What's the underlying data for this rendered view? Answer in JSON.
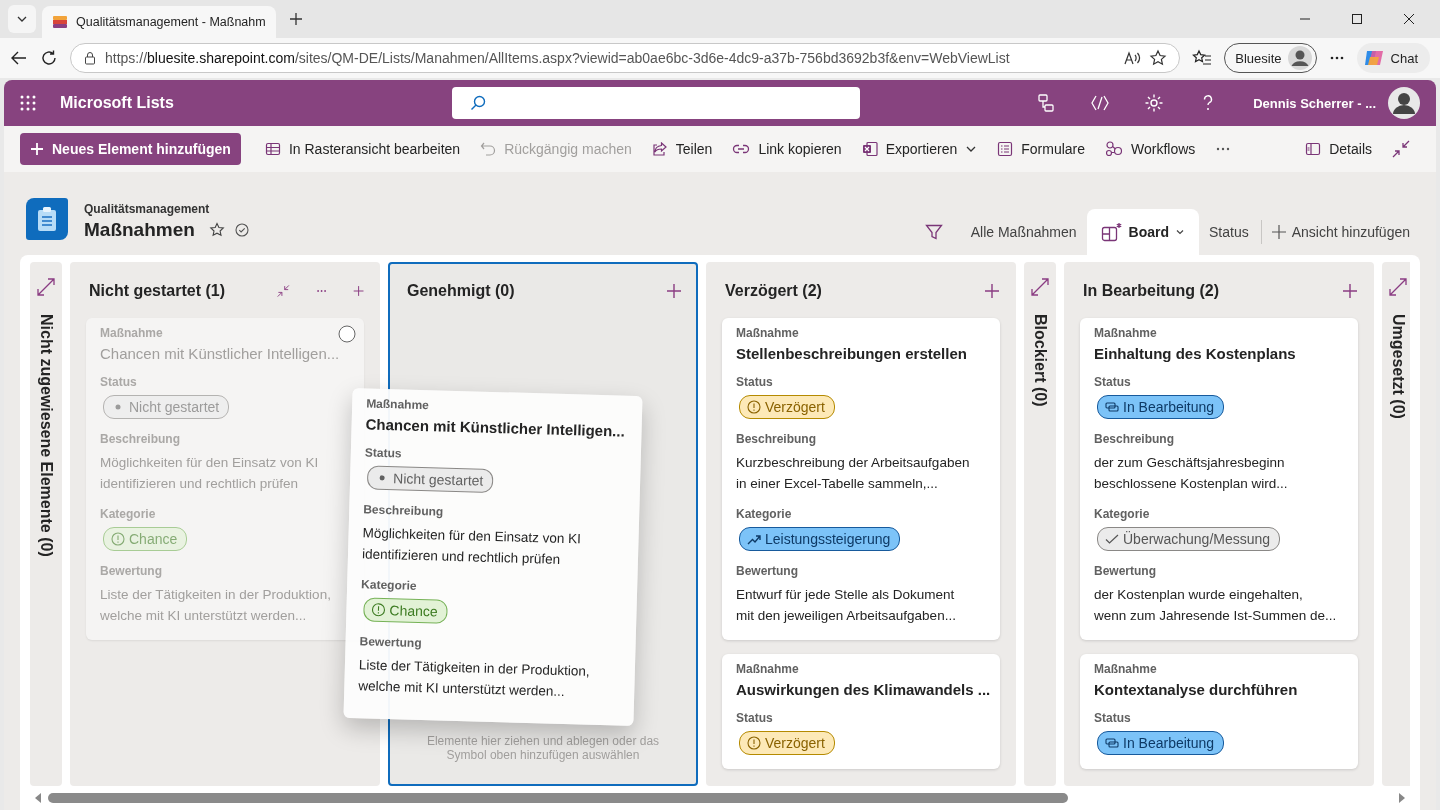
{
  "browser": {
    "tab_title": "Qualitätsmanagement - Maßnahm",
    "url_scheme": "https://",
    "url_host": "bluesite.sharepoint.com",
    "url_path": "/sites/QM-DE/Lists/Manahmen/AllItems.aspx?viewid=ab0ae6bc-3d6e-4dc9-a37b-756bd3692b3f&env=WebViewList",
    "profile": "Bluesite",
    "chat": "Chat"
  },
  "app": {
    "name": "Microsoft Lists",
    "user": "Dennis Scherrer - ..."
  },
  "commands": {
    "new_item": "Neues Element hinzufügen",
    "details": "Details",
    "items": [
      {
        "label": "In Rasteransicht bearbeiten",
        "disabled": false,
        "dropdown": false
      },
      {
        "label": "Rückgängig machen",
        "disabled": true,
        "dropdown": false
      },
      {
        "label": "Teilen",
        "disabled": false,
        "dropdown": false
      },
      {
        "label": "Link kopieren",
        "disabled": false,
        "dropdown": false
      },
      {
        "label": "Exportieren",
        "disabled": false,
        "dropdown": true
      },
      {
        "label": "Formulare",
        "disabled": false,
        "dropdown": false
      },
      {
        "label": "Workflows",
        "disabled": false,
        "dropdown": false
      }
    ]
  },
  "list": {
    "site": "Qualitätsmanagement",
    "title": "Maßnahmen",
    "favorite": false
  },
  "views": [
    {
      "label": "Alle Maßnahmen",
      "selected": false
    },
    {
      "label": "Board",
      "selected": true
    },
    {
      "label": "Status",
      "selected": false
    }
  ],
  "add_view": "Ansicht hinzufügen",
  "board": {
    "columns": [
      {
        "title": "Nicht zugewiesene Elemente (0)",
        "kind": "collapsed"
      },
      {
        "title": "Nicht gestartet (1)",
        "kind": "expanded",
        "hovered": true,
        "focused": false,
        "cards": [
          {
            "dragging": true,
            "title_label": "Maßnahme",
            "title": "Chancen mit Künstlicher Intelligen...",
            "fields": [
              {
                "label": "Status",
                "kind": "tag",
                "tag": {
                  "text": "Nicht gestartet",
                  "kind": "not-started"
                }
              },
              {
                "label": "Beschreibung",
                "kind": "text",
                "text": "Möglichkeiten für den Einsatz von KI\nidentifizieren und rechtlich prüfen"
              },
              {
                "label": "Kategorie",
                "kind": "tag",
                "tag": {
                  "text": "Chance",
                  "kind": "opportunity"
                }
              },
              {
                "label": "Bewertung",
                "kind": "text",
                "text": "Liste der Tätigkeiten in der Produktion,\nwelche mit KI unterstützt werden..."
              }
            ]
          }
        ]
      },
      {
        "title": "Genehmigt (0)",
        "kind": "expanded",
        "hovered": false,
        "focused": true,
        "drop_hint": "Elemente hier ziehen und ablegen oder das Symbol oben hinzufügen auswählen"
      },
      {
        "title": "Verzögert (2)",
        "kind": "expanded",
        "hovered": false,
        "focused": false,
        "cards": [
          {
            "dragging": false,
            "title_label": "Maßnahme",
            "title": "Stellenbeschreibungen erstellen",
            "fields": [
              {
                "label": "Status",
                "kind": "tag",
                "tag": {
                  "text": "Verzögert",
                  "kind": "delayed"
                }
              },
              {
                "label": "Beschreibung",
                "kind": "text",
                "text": "Kurzbeschreibung der Arbeitsaufgaben\nin einer Excel-Tabelle sammeln,..."
              },
              {
                "label": "Kategorie",
                "kind": "tag",
                "tag": {
                  "text": "Leistungssteigerung",
                  "kind": "improvement"
                }
              },
              {
                "label": "Bewertung",
                "kind": "text",
                "text": "Entwurf für jede Stelle als Dokument\nmit den jeweiligen Arbeitsaufgaben..."
              }
            ]
          },
          {
            "dragging": false,
            "title_label": "Maßnahme",
            "title": "Auswirkungen des Klimawandels ...",
            "fields": [
              {
                "label": "Status",
                "kind": "tag",
                "tag": {
                  "text": "Verzögert",
                  "kind": "delayed"
                }
              }
            ]
          }
        ]
      },
      {
        "title": "Blockiert (0)",
        "kind": "collapsed"
      },
      {
        "title": "In Bearbeitung (2)",
        "kind": "expanded",
        "hovered": false,
        "focused": false,
        "cards": [
          {
            "dragging": false,
            "title_label": "Maßnahme",
            "title": "Einhaltung des Kostenplans",
            "fields": [
              {
                "label": "Status",
                "kind": "tag",
                "tag": {
                  "text": "In Bearbeitung",
                  "kind": "in-progress"
                }
              },
              {
                "label": "Beschreibung",
                "kind": "text",
                "text": "der zum Geschäftsjahresbeginn\nbeschlossene Kostenplan wird..."
              },
              {
                "label": "Kategorie",
                "kind": "tag",
                "tag": {
                  "text": "Überwachung/Messung",
                  "kind": "monitoring"
                }
              },
              {
                "label": "Bewertung",
                "kind": "text",
                "text": "der Kostenplan wurde eingehalten,\nwenn zum Jahresende Ist-Summen de..."
              }
            ]
          },
          {
            "dragging": false,
            "title_label": "Maßnahme",
            "title": "Kontextanalyse durchführen",
            "fields": [
              {
                "label": "Status",
                "kind": "tag",
                "tag": {
                  "text": "In Bearbeitung",
                  "kind": "in-progress"
                }
              }
            ]
          }
        ]
      },
      {
        "title": "Umgesetzt (0)",
        "kind": "collapsed"
      }
    ],
    "drag_preview": {
      "title_label": "Maßnahme",
      "title": "Chancen mit Künstlicher Intelligen...",
      "fields": [
        {
          "label": "Status",
          "kind": "tag",
          "tag": {
            "text": "Nicht gestartet",
            "kind": "not-started"
          }
        },
        {
          "label": "Beschreibung",
          "kind": "text",
          "text": "Möglichkeiten für den Einsatz von KI\nidentifizieren und rechtlich prüfen"
        },
        {
          "label": "Kategorie",
          "kind": "tag",
          "tag": {
            "text": "Chance",
            "kind": "opportunity"
          }
        },
        {
          "label": "Bewertung",
          "kind": "text",
          "text": "Liste der Tätigkeiten in der Produktion,\nwelche mit KI unterstützt werden..."
        }
      ]
    }
  }
}
